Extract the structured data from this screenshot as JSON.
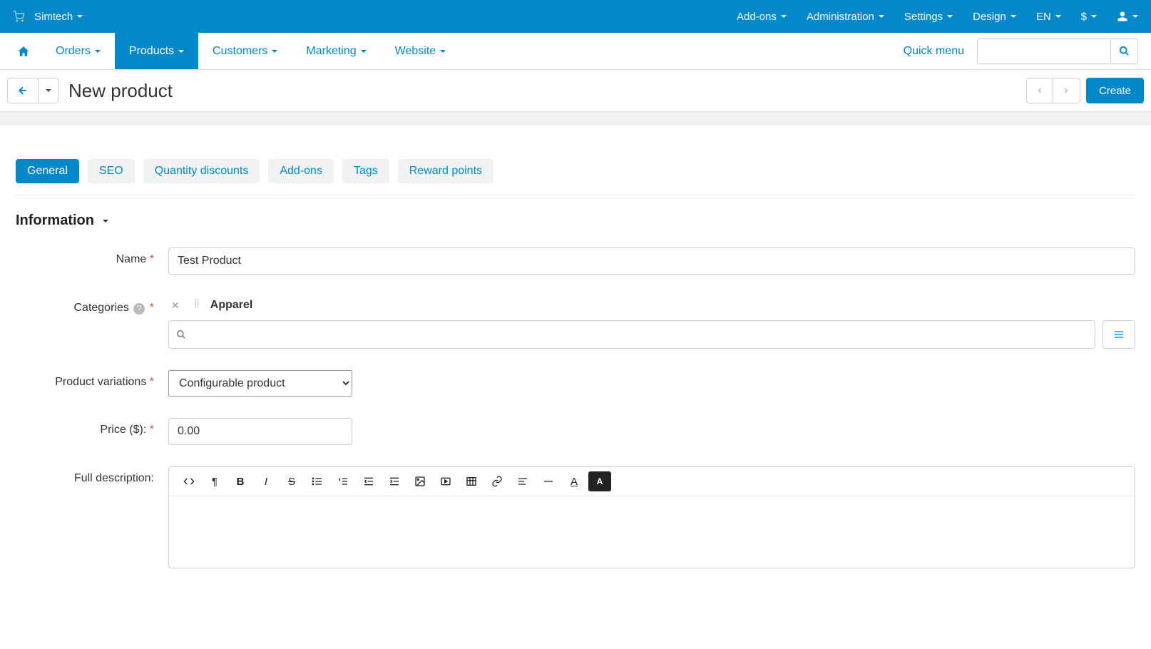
{
  "topbar": {
    "brand": "Simtech",
    "right": {
      "addons": "Add-ons",
      "administration": "Administration",
      "settings": "Settings",
      "design": "Design",
      "lang": "EN",
      "currency": "$"
    }
  },
  "nav": {
    "orders": "Orders",
    "products": "Products",
    "customers": "Customers",
    "marketing": "Marketing",
    "website": "Website",
    "quick_menu": "Quick menu",
    "search_placeholder": ""
  },
  "page": {
    "title": "New product",
    "create": "Create"
  },
  "tabs": [
    "General",
    "SEO",
    "Quantity discounts",
    "Add-ons",
    "Tags",
    "Reward points"
  ],
  "section": {
    "information": "Information"
  },
  "form": {
    "name_label": "Name",
    "name_value": "Test Product",
    "categories_label": "Categories",
    "category_chip": "Apparel",
    "category_search_placeholder": "",
    "variations_label": "Product variations",
    "variations_value": "Configurable product",
    "price_label": "Price ($):",
    "price_value": "0.00",
    "description_label": "Full description:"
  }
}
